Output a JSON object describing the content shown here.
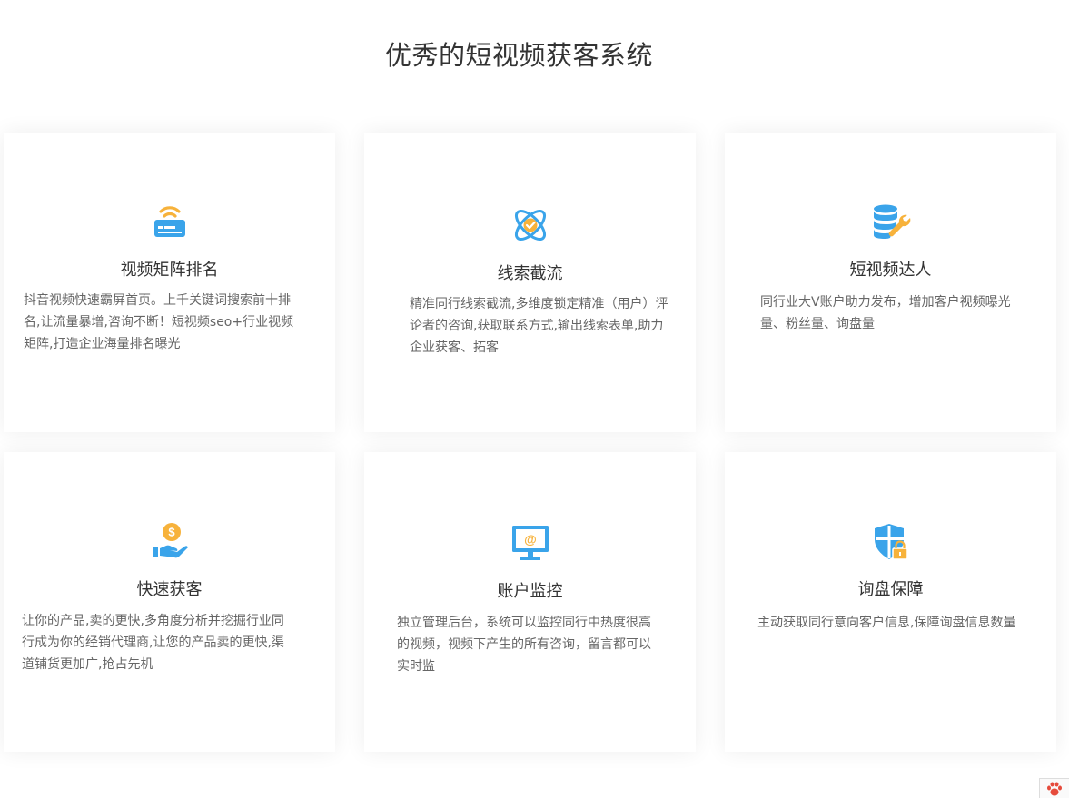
{
  "page": {
    "title": "优秀的短视频获客系统"
  },
  "cards": [
    {
      "title": "视频矩阵排名",
      "description": "抖音视频快速霸屏首页。上千关键词搜索前十排名,让流量暴增,咨询不断！短视频seo+行业视频矩阵,打造企业海量排名曝光",
      "icon": "router-wifi-icon"
    },
    {
      "title": "线索截流",
      "description": "精准同行线索截流,多维度锁定精准（用户）评论者的咨询,获取联系方式,输出线索表单,助力企业获客、拓客",
      "icon": "atom-check-icon"
    },
    {
      "title": "短视频达人",
      "description": "同行业大V账户助力发布，增加客户视频曝光量、粉丝量、询盘量",
      "icon": "database-wrench-icon"
    },
    {
      "title": "快速获客",
      "description": "让你的产品,卖的更快,多角度分析并挖掘行业同行成为你的经销代理商,让您的产品卖的更快,渠道铺货更加广,抢占先机",
      "icon": "hand-coin-icon"
    },
    {
      "title": "账户监控",
      "description": "独立管理后台，系统可以监控同行中热度很高的视频，视频下产生的所有咨询，留言都可以实时监",
      "icon": "monitor-at-icon"
    },
    {
      "title": "询盘保障",
      "description": "主动获取同行意向客户信息,保障询盘信息数量",
      "icon": "shield-lock-icon"
    }
  ],
  "colors": {
    "blue": "#3aa4ea",
    "orange": "#f7b23b",
    "title_text": "#333333",
    "desc_text": "#666666"
  },
  "widget": {
    "icon": "paw-icon",
    "color": "#e64b3c"
  }
}
